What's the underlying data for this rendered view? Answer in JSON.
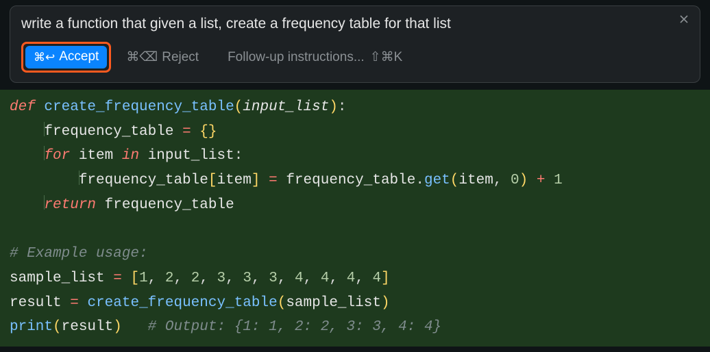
{
  "prompt": {
    "text": "write a function that given a list, create a frequency table for that list"
  },
  "actions": {
    "accept": {
      "shortcut": "⌘↩",
      "label": "Accept"
    },
    "reject": {
      "shortcut": "⌘⌫",
      "label": "Reject"
    },
    "followup": {
      "placeholder": "Follow-up instructions...",
      "shortcut": "⇧⌘K"
    }
  },
  "code": {
    "line1": {
      "kw": "def",
      "fn": "create_frequency_table",
      "lp": "(",
      "param": "input_list",
      "rp": ")",
      "colon": ":"
    },
    "line2": {
      "indent": "    ",
      "var": "frequency_table",
      "sp1": " ",
      "op": "=",
      "sp2": " ",
      "lb": "{",
      "rb": "}"
    },
    "line3": {
      "indent": "    ",
      "kw": "for",
      "sp1": " ",
      "v1": "item",
      "sp2": " ",
      "kw2": "in",
      "sp3": " ",
      "v2": "input_list",
      "colon": ":"
    },
    "line4": {
      "indent": "        ",
      "v1": "frequency_table",
      "lb": "[",
      "v2": "item",
      "rb": "]",
      "sp1": " ",
      "op": "=",
      "sp2": " ",
      "v3": "frequency_table",
      "dot": ".",
      "m": "get",
      "lp": "(",
      "a1": "item",
      "comma": ",",
      "sp3": " ",
      "n": "0",
      "rp": ")",
      "sp4": " ",
      "plus": "+",
      "sp5": " ",
      "one": "1"
    },
    "line5": {
      "indent": "    ",
      "kw": "return",
      "sp": " ",
      "v": "frequency_table"
    },
    "line6": {
      "blank": " "
    },
    "line7": {
      "cmt": "# Example usage:"
    },
    "line8": {
      "v": "sample_list",
      "sp1": " ",
      "op": "=",
      "sp2": " ",
      "lb": "[",
      "n1": "1",
      "c1": ",",
      "s1": " ",
      "n2": "2",
      "c2": ",",
      "s2": " ",
      "n3": "2",
      "c3": ",",
      "s3": " ",
      "n4": "3",
      "c4": ",",
      "s4": " ",
      "n5": "3",
      "c5": ",",
      "s5": " ",
      "n6": "3",
      "c6": ",",
      "s6": " ",
      "n7": "4",
      "c7": ",",
      "s7": " ",
      "n8": "4",
      "c8": ",",
      "s8": " ",
      "n9": "4",
      "c9": ",",
      "s9": " ",
      "n10": "4",
      "rb": "]"
    },
    "line9": {
      "v": "result",
      "sp1": " ",
      "op": "=",
      "sp2": " ",
      "fn": "create_frequency_table",
      "lp": "(",
      "arg": "sample_list",
      "rp": ")"
    },
    "line10": {
      "fn": "print",
      "lp": "(",
      "arg": "result",
      "rp": ")",
      "sp": "   ",
      "cmt": "# Output: {1: 1, 2: 2, 3: 3, 4: 4}"
    }
  }
}
